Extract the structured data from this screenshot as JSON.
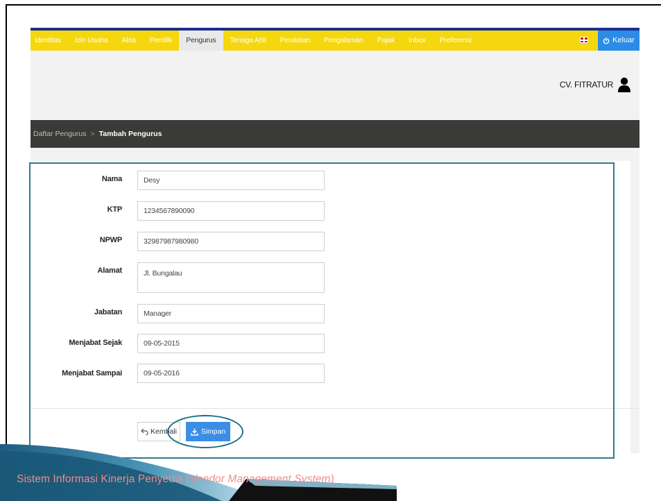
{
  "nav": {
    "items": [
      "Identitas",
      "Izin Usaha",
      "Akta",
      "Pemilik",
      "Pengurus",
      "Tenaga Ahli",
      "Peralatan",
      "Pengalaman",
      "Pajak",
      "Inbox",
      "Preferensi"
    ],
    "active": "Pengurus",
    "logout_label": "Keluar",
    "language_icon": "uk-flag-icon"
  },
  "header": {
    "company_name": "CV. FITRATUR",
    "user_icon": "user-icon"
  },
  "breadcrumb": {
    "parent": "Daftar Pengurus",
    "separator": ">",
    "current": "Tambah Pengurus"
  },
  "form": {
    "fields": [
      {
        "label": "Nama",
        "value": "Desy"
      },
      {
        "label": "KTP",
        "value": "1234567890090"
      },
      {
        "label": "NPWP",
        "value": "32987987980980"
      },
      {
        "label": "Alamat",
        "value": "Jl. Bungalau"
      },
      {
        "label": "Jabatan",
        "value": "Manager"
      },
      {
        "label": "Menjabat Sejak",
        "value": "09-05-2015"
      },
      {
        "label": "Menjabat Sampai",
        "value": "09-05-2016"
      }
    ],
    "back_label": "Kembali",
    "save_label": "Simpan"
  },
  "footer": {
    "text": "Sistem Informasi Kinerja Penyedia",
    "text_italic": "(Vendor Management System)"
  },
  "colors": {
    "nav_bg": "#f5d70f",
    "nav_border": "#1f2e8c",
    "logout_bg": "#2a8ce6",
    "breadcrumb_bg": "#3a3a38",
    "save_bg": "#3b8ee6",
    "outline": "#2e7a8c",
    "footer_text": "#f08a8a"
  }
}
